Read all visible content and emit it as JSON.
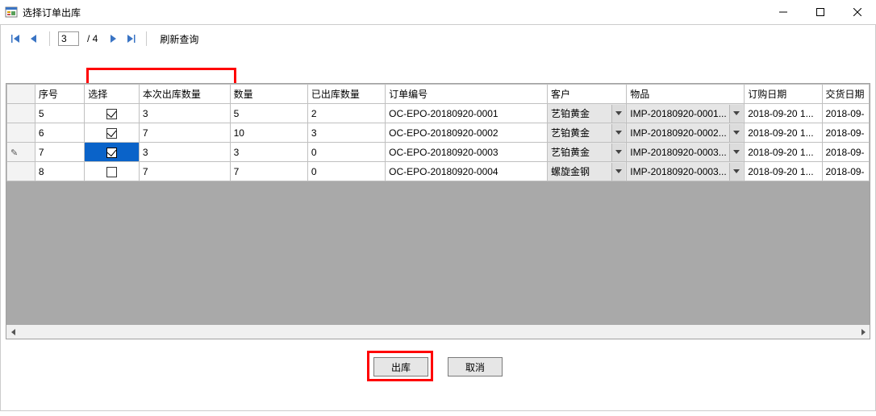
{
  "window": {
    "title": "选择订单出库"
  },
  "nav": {
    "page_current": "3",
    "page_total": "/ 4",
    "refresh_label": "刷新查询"
  },
  "columns": {
    "seq": "序号",
    "select": "选择",
    "this_out_qty": "本次出库数量",
    "qty": "数量",
    "outed_qty": "已出库数量",
    "order_no": "订单编号",
    "customer": "客户",
    "item": "物品",
    "order_date": "订购日期",
    "deliver_date": "交货日期"
  },
  "rows": [
    {
      "marker": "",
      "seq": "5",
      "selected": true,
      "sel_active": false,
      "this_out_qty": "3",
      "qty": "5",
      "outed_qty": "2",
      "order_no": "OC-EPO-20180920-0001",
      "customer": "艺铂黄金",
      "item": "IMP-20180920-0001...",
      "order_date": "2018-09-20 1...",
      "deliver_date": "2018-09-"
    },
    {
      "marker": "",
      "seq": "6",
      "selected": true,
      "sel_active": false,
      "this_out_qty": "7",
      "qty": "10",
      "outed_qty": "3",
      "order_no": "OC-EPO-20180920-0002",
      "customer": "艺铂黄金",
      "item": "IMP-20180920-0002...",
      "order_date": "2018-09-20 1...",
      "deliver_date": "2018-09-"
    },
    {
      "marker": "pencil",
      "seq": "7",
      "selected": true,
      "sel_active": true,
      "this_out_qty": "3",
      "qty": "3",
      "outed_qty": "0",
      "order_no": "OC-EPO-20180920-0003",
      "customer": "艺铂黄金",
      "item": "IMP-20180920-0003...",
      "order_date": "2018-09-20 1...",
      "deliver_date": "2018-09-"
    },
    {
      "marker": "",
      "seq": "8",
      "selected": false,
      "sel_active": false,
      "this_out_qty": "7",
      "qty": "7",
      "outed_qty": "0",
      "order_no": "OC-EPO-20180920-0004",
      "customer": "螺旋金钢",
      "item": "IMP-20180920-0003...",
      "order_date": "2018-09-20 1...",
      "deliver_date": "2018-09-"
    }
  ],
  "buttons": {
    "outbound": "出库",
    "cancel": "取消"
  }
}
